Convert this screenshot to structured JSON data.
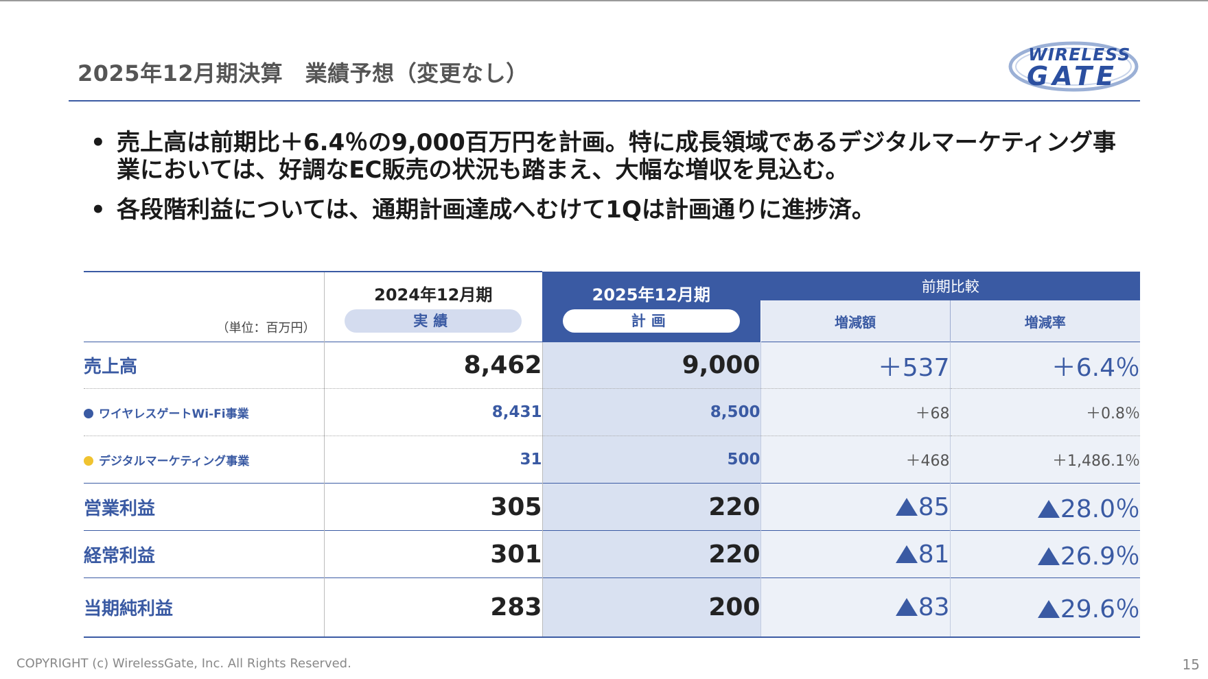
{
  "slide": {
    "title": "2025年12月期決算　業績予想（変更なし）",
    "logo_line1": "WIRELESS",
    "logo_line2": "GATE",
    "bullets": [
      "売上高は前期比＋6.4％の9,000百万円を計画。特に成長領域であるデジタルマーケティング事業においては、好調なEC販売の状況も踏まえ、大幅な増収を見込む。",
      "各段階利益については、通期計画達成へむけて1Qは計画通りに進捗済。"
    ],
    "bullet_mark": "•",
    "copyright": "COPYRIGHT (c) WirelessGate, Inc. All Rights Reserved.",
    "page_number": "15"
  },
  "table": {
    "unit": "（単位：百万円）",
    "col_actual_year": "2024年12月期",
    "col_actual_tag": "実績",
    "col_plan_year": "2025年12月期",
    "col_plan_tag": "計画",
    "compare_header": "前期比較",
    "compare_amount": "増減額",
    "compare_rate": "増減率",
    "rows": [
      {
        "label": "売上高",
        "actual": "8,462",
        "plan": "9,000",
        "diff": "＋537",
        "rate": "＋6.4％"
      },
      {
        "label": "ワイヤレスゲートWi-Fi事業",
        "actual": "8,431",
        "plan": "8,500",
        "diff": "＋68",
        "rate": "＋0.8％",
        "dot_color": "#3a5aa3"
      },
      {
        "label": "デジタルマーケティング事業",
        "actual": "31",
        "plan": "500",
        "diff": "＋468",
        "rate": "＋1,486.1％",
        "dot_color": "#f0c330"
      },
      {
        "label": "営業利益",
        "actual": "305",
        "plan": "220",
        "diff": "85",
        "rate": "28.0％"
      },
      {
        "label": "経常利益",
        "actual": "301",
        "plan": "220",
        "diff": "81",
        "rate": "26.9％"
      },
      {
        "label": "当期純利益",
        "actual": "283",
        "plan": "200",
        "diff": "83",
        "rate": "29.6％"
      }
    ]
  },
  "colors": {
    "accent": "#3a5aa3",
    "plan_fill": "#d9e1f1",
    "compare_fill": "#edf1f8"
  }
}
